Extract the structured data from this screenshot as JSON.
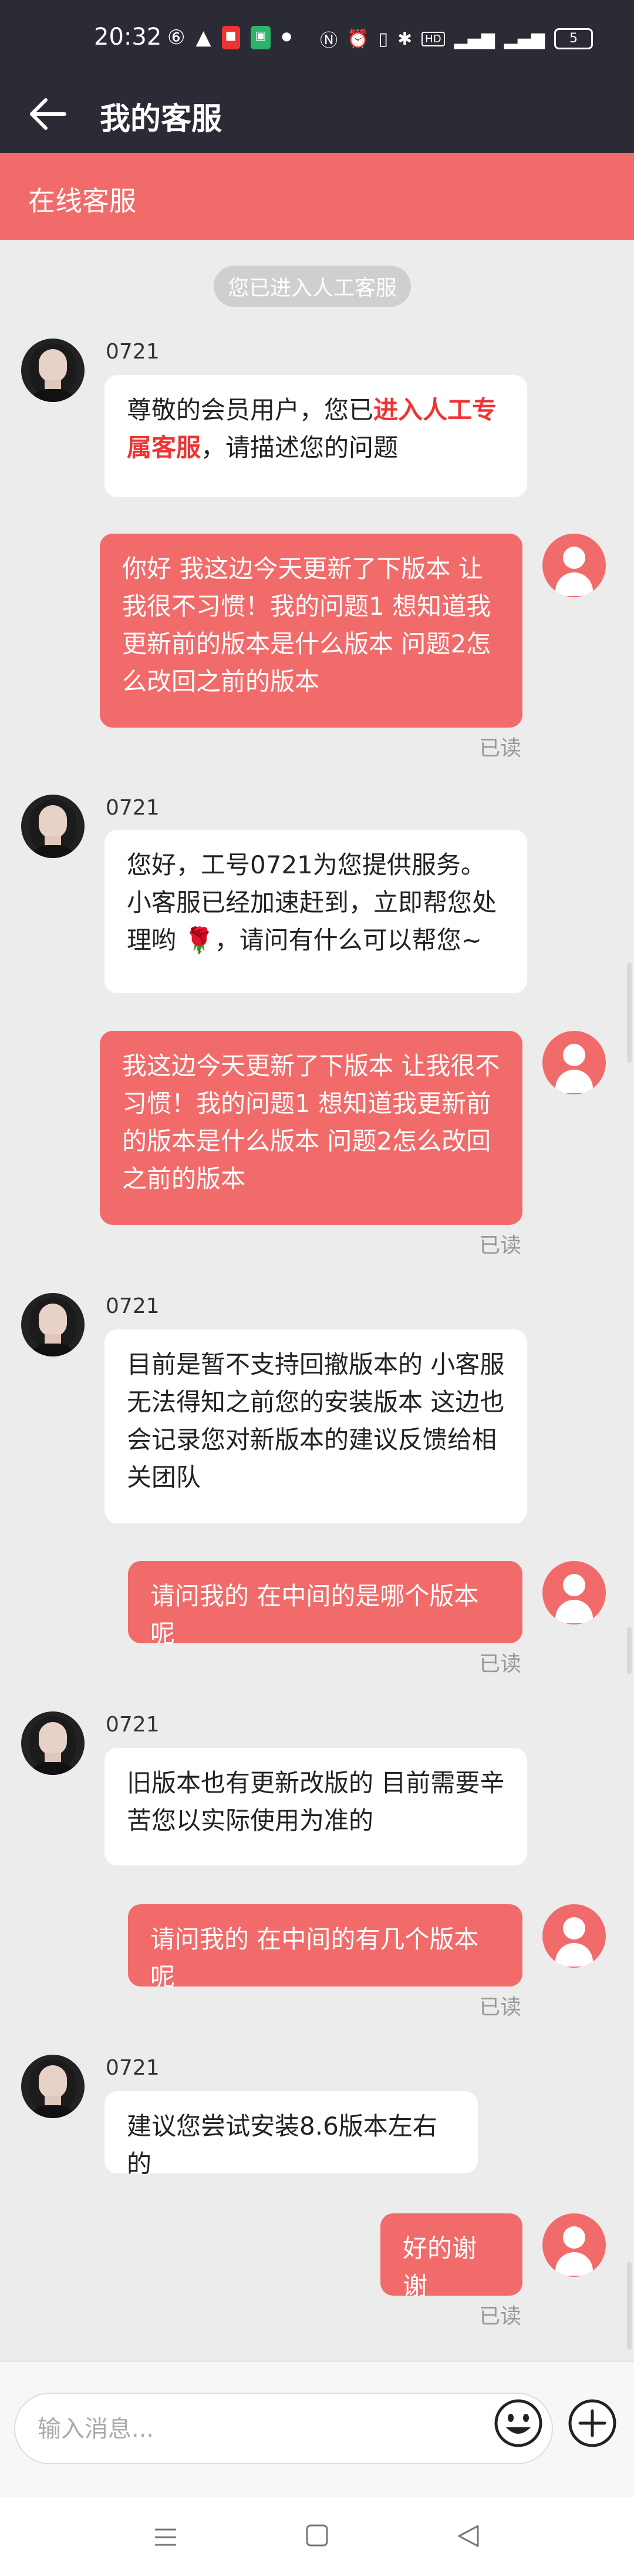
{
  "status_bar": {
    "time": "20:32",
    "left_icons": [
      "weibo-icon",
      "warning-icon",
      "app-badge-icon",
      "phone-app-icon",
      "dot-icon"
    ],
    "right_icons": [
      "nfc-icon",
      "alarm-icon",
      "vibrate-icon",
      "bluetooth-icon",
      "hd-icon",
      "signal-4g-icon",
      "signal-4g-2-icon"
    ],
    "battery": "5"
  },
  "header": {
    "title": "我的客服"
  },
  "subbar": {
    "label": "在线客服"
  },
  "system_notice": "您已进入人工客服",
  "messages": [
    {
      "sender": "agent",
      "name": "0721",
      "text_before": "尊敬的会员用户，您已",
      "highlight": "进入人工专属客服",
      "text_after": "，请描述您的问题"
    },
    {
      "sender": "user",
      "text": "你好 我这边今天更新了下版本 让我很不习惯！我的问题1  想知道我更新前的版本是什么版本   问题2怎么改回之前的版本",
      "status": "已读"
    },
    {
      "sender": "agent",
      "name": "0721",
      "text_before": "您好，工号0721为您提供服务。 小客服已经加速赶到，立即帮您处理哟 ",
      "emoji": "🌹",
      "text_after": "，请问有什么可以帮您~"
    },
    {
      "sender": "user",
      "text": "我这边今天更新了下版本 让我很不习惯！我的问题1  想知道我更新前的版本是什么版本   问题2怎么改回之前的版本",
      "status": "已读"
    },
    {
      "sender": "agent",
      "name": "0721",
      "text": "目前是暂不支持回撤版本的 小客服无法得知之前您的安装版本 这边也会记录您对新版本的建议反馈给相关团队"
    },
    {
      "sender": "user",
      "text": "请问我的 在中间的是哪个版本呢",
      "status": "已读"
    },
    {
      "sender": "agent",
      "name": "0721",
      "text": "旧版本也有更新改版的 目前需要辛苦您以实际使用为准的"
    },
    {
      "sender": "user",
      "text": "请问我的 在中间的有几个版本呢",
      "status": "已读"
    },
    {
      "sender": "agent",
      "name": "0721",
      "text": "建议您尝试安装8.6版本左右的"
    },
    {
      "sender": "user",
      "text": "好的谢谢",
      "status": "已读"
    }
  ],
  "input": {
    "placeholder": "输入消息..."
  },
  "colors": {
    "accent": "#f26b6b",
    "header_bg": "#2b2b35",
    "chat_bg": "#ececec"
  }
}
